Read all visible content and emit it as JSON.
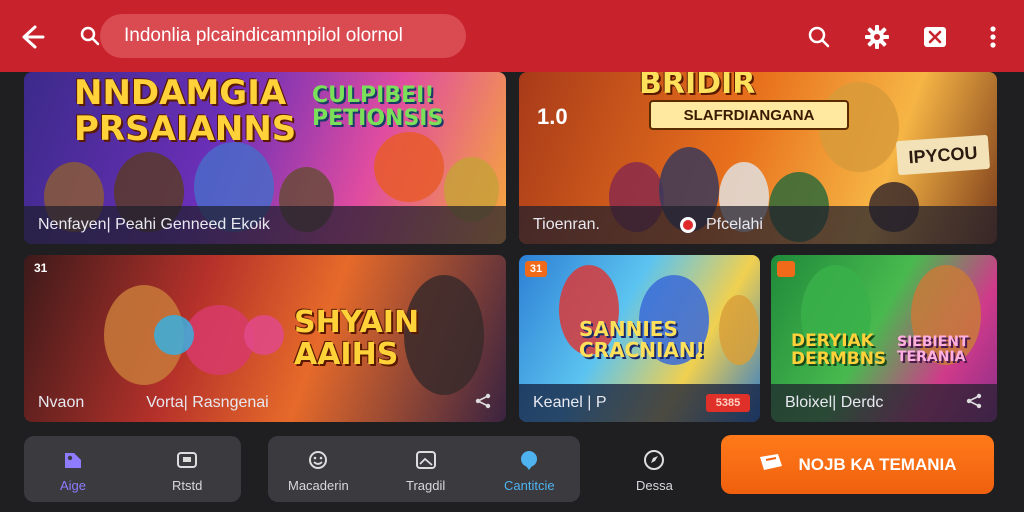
{
  "topbar": {
    "search_text": "Indonlia plcaindicamnpilol olornol",
    "accent": "#c8232c",
    "icons": [
      "back-arrow-icon",
      "search-icon",
      "search-icon",
      "gear-icon",
      "close-icon",
      "more-vert-icon"
    ]
  },
  "cards": [
    {
      "art_title": "NNDAMGIA PRSAIANNS",
      "art_sub": "CULPIBEI! PETIONSIS",
      "caption": "Nenfayen| Peahi Genneed Ekoik"
    },
    {
      "art_title": "BRIDIR",
      "art_banner": "SLAFRDIANGANA",
      "art_score": "1.0",
      "art_tag": "IPYCOU",
      "caption_left": "Tioenran.",
      "caption_right": "Pfcelahi"
    },
    {
      "corner": "31",
      "art_title": "SHYAIN AAIHS",
      "caption_left": "Nvaon",
      "caption_right": "Vorta| Rasngenai"
    },
    {
      "corner": "31",
      "art_title": "SANNIES CRACNIAN!",
      "caption": "Keanel | P",
      "price": "5385"
    },
    {
      "art_title": "DERYIAK DERMBNS",
      "art_sub": "SIEBIENT TERANIA",
      "caption": "Bloixel| Derdc"
    }
  ],
  "nav": {
    "group1": [
      {
        "label": "Aige",
        "icon": "game-controller-icon"
      },
      {
        "label": "Rtstd",
        "icon": "tv-icon"
      }
    ],
    "group2": [
      {
        "label": "Macaderin",
        "icon": "smiley-icon"
      },
      {
        "label": "Tragdil",
        "icon": "image-icon"
      },
      {
        "label": "Cantitcie",
        "icon": "chat-icon"
      }
    ],
    "extra": {
      "label": "Dessa",
      "icon": "compass-icon"
    },
    "cta": "NOJB KA TEMANIA"
  }
}
